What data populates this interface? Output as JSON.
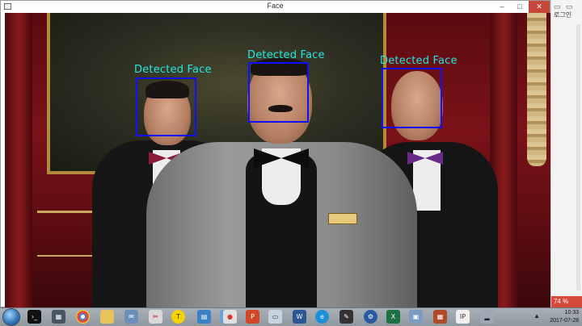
{
  "window": {
    "title": "Face",
    "minimize_glyph": "–",
    "maximize_glyph": "□",
    "close_glyph": "✕"
  },
  "detections": [
    {
      "label": "Detected Face"
    },
    {
      "label": "Detected Face"
    },
    {
      "label": "Detected Face"
    }
  ],
  "side_panel": {
    "login_label": "로그인",
    "zoom_label": "74 %"
  },
  "taskbar": {
    "icons": [
      "start-orb-icon",
      "cmd-icon",
      "file-explorer-icon",
      "chrome-icon",
      "folder-icon",
      "mail-icon",
      "tools-icon",
      "kakaotalk-icon",
      "notepad-icon",
      "zoom-tool-icon",
      "record-icon",
      "powerpoint-icon",
      "app-icon",
      "word-icon",
      "ie-icon",
      "paint-icon",
      "settings-icon",
      "excel-icon",
      "app2-icon",
      "calendar-icon",
      "ip-icon",
      "network-icon"
    ],
    "time": "10:33",
    "date": "2017-07-28"
  },
  "colors": {
    "detection_box": "#1010ff",
    "detection_text": "#25e6e6",
    "close_button": "#c7463a",
    "zoom_badge": "#d64a3a"
  }
}
